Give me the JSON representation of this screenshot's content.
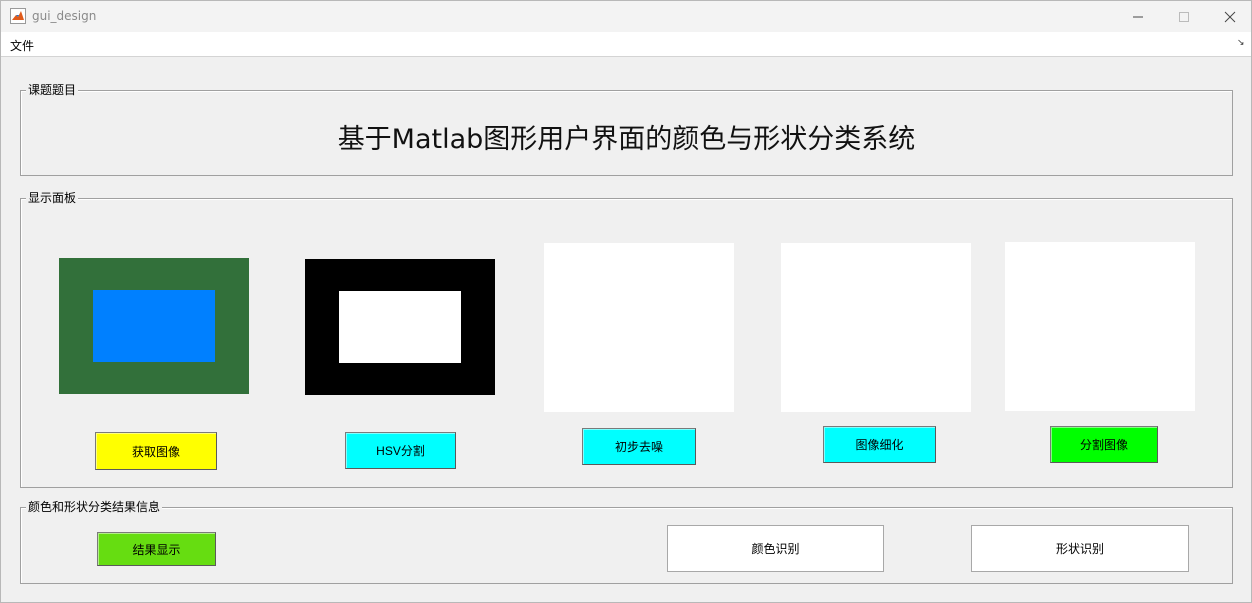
{
  "window": {
    "title": "gui_design",
    "app_icon": "matlab-icon"
  },
  "menu": {
    "file_label": "文件",
    "overflow_arrow": "↘"
  },
  "panels": {
    "topic": {
      "label": "课题题目",
      "title": "基于Matlab图形用户界面的颜色与形状分类系统"
    },
    "display": {
      "label": "显示面板",
      "buttons": [
        {
          "label": "获取图像",
          "color": "#ffff00"
        },
        {
          "label": "HSV分割",
          "color": "#00ffff"
        },
        {
          "label": "初步去噪",
          "color": "#00ffff"
        },
        {
          "label": "图像细化",
          "color": "#00ffff"
        },
        {
          "label": "分割图像",
          "color": "#00ff00"
        }
      ],
      "images": [
        {
          "outer_color": "#32703a",
          "inner_color": "#0080ff"
        },
        {
          "outer_color": "#000000",
          "inner_color": "#ffffff"
        },
        {
          "color": "#ffffff"
        },
        {
          "color": "#ffffff"
        },
        {
          "color": "#ffffff"
        }
      ]
    },
    "result": {
      "label": "颜色和形状分类结果信息",
      "show_button": {
        "label": "结果显示",
        "color": "#66dd11"
      },
      "color_box": "颜色识别",
      "shape_box": "形状识别"
    }
  }
}
